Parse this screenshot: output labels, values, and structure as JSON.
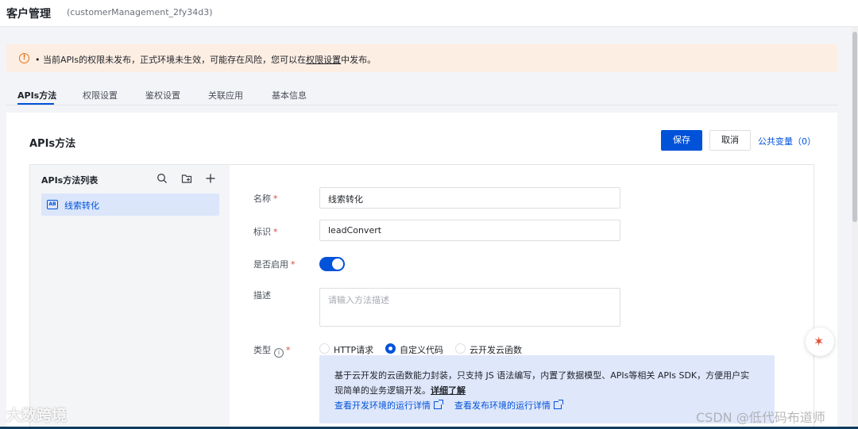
{
  "header": {
    "title": "客户管理",
    "subtitle": "(customerManagement_2fy34d3)"
  },
  "alert": {
    "prefix": "• 当前APIs的权限未发布，正式环境未生效，可能存在风险，您可以在",
    "link": "权限设置",
    "suffix": "中发布。"
  },
  "tabs": [
    {
      "label": "APIs方法"
    },
    {
      "label": "权限设置"
    },
    {
      "label": "鉴权设置"
    },
    {
      "label": "关联应用"
    },
    {
      "label": "基本信息"
    }
  ],
  "panel": {
    "title": "APIs方法",
    "save_label": "保存",
    "cancel_label": "取消",
    "public_vars_label": "公共变量（0）"
  },
  "method_list": {
    "title": "APIs方法列表",
    "items": [
      {
        "label": "线索转化",
        "icon_text": "AB"
      }
    ]
  },
  "form": {
    "name_label": "名称",
    "name_value": "线索转化",
    "id_label": "标识",
    "id_value": "leadConvert",
    "enabled_label": "是否启用",
    "enabled": true,
    "desc_label": "描述",
    "desc_placeholder": "请输入方法描述",
    "type_label": "类型",
    "type_options": [
      {
        "label": "HTTP请求",
        "selected": false
      },
      {
        "label": "自定义代码",
        "selected": true
      },
      {
        "label": "云开发云函数",
        "selected": false
      }
    ],
    "type_desc_line1": "基于云开发的云函数能力封装，只支持 JS 语法编写，内置了数据模型、APIs等相关 APIs SDK，方便用户实",
    "type_desc_line2": "现简单的业务逻辑开发。",
    "type_desc_more": "详细了解",
    "dev_detail_link": "查看开发环境的运行详情",
    "prod_detail_link": "查看发布环境的运行详情"
  },
  "watermarks": {
    "left": "大数跨境",
    "right": "CSDN @低代码布道师"
  },
  "colors": {
    "primary": "#0052d9",
    "warning": "#e37318",
    "alert_bg": "#fdeee3"
  }
}
